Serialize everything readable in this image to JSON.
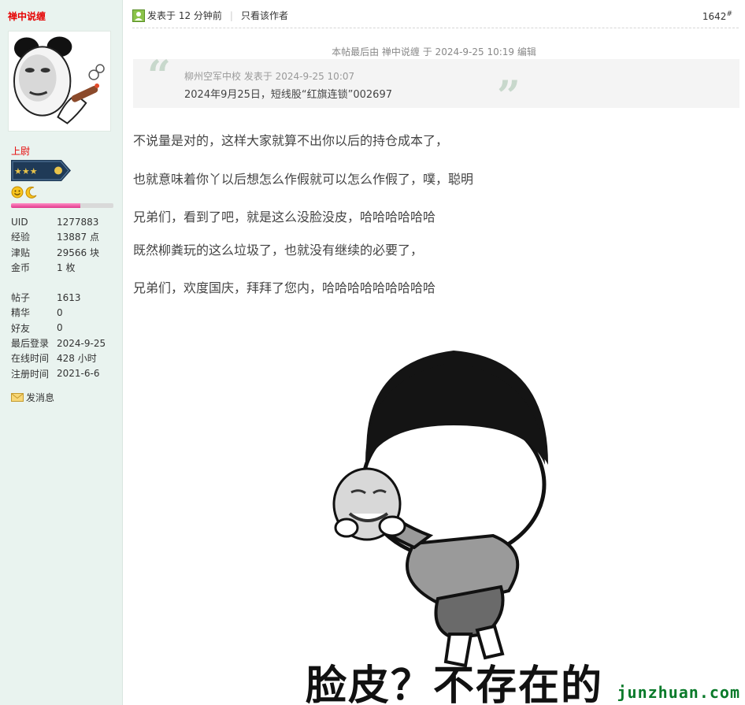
{
  "author": {
    "name": "禅中说缠",
    "rank_title": "上尉",
    "level_progress_pct": 68,
    "send_message_label": "发消息"
  },
  "profile_stats": [
    {
      "label": "UID",
      "value": "1277883"
    },
    {
      "label": "经验",
      "value": "13887 点"
    },
    {
      "label": "津贴",
      "value": "29566 块"
    },
    {
      "label": "金币",
      "value": "1 枚"
    }
  ],
  "profile_stats2": [
    {
      "label": "帖子",
      "value": "1613"
    },
    {
      "label": "精华",
      "value": "0"
    },
    {
      "label": "好友",
      "value": "0"
    },
    {
      "label": "最后登录",
      "value": "2024-9-25"
    },
    {
      "label": "在线时间",
      "value": "428 小时"
    },
    {
      "label": "注册时间",
      "value": "2021-6-6"
    }
  ],
  "post_header": {
    "posted": "发表于 12 分钟前",
    "separator": "|",
    "only_author": "只看该作者",
    "floor_number": "1642",
    "floor_suffix": "#"
  },
  "edit_note": "本帖最后由 禅中说缠 于 2024-9-25 10:19 编辑",
  "quote": {
    "author_line": "柳州空军中校 发表于 2024-9-25 10:07",
    "text": "2024年9月25日，短线股“红旗连锁”002697"
  },
  "paragraphs": [
    "不说量是对的，这样大家就算不出你以后的持仓成本了，",
    "也就意味着你丫以后想怎么作假就可以怎么作假了，噗，聪明",
    "兄弟们，看到了吧，就是这么没脸没皮，哈哈哈哈哈哈",
    "既然柳粪玩的这么垃圾了，也就没有继续的必要了，",
    "兄弟们，欢度国庆，拜拜了您内，哈哈哈哈哈哈哈哈哈"
  ],
  "meme_caption": "脸皮？不存在的",
  "watermark": "junzhuan.com",
  "colors": {
    "sidebar_bg": "#e9f3ef",
    "username": "#e60000",
    "watermark": "#0a7a2a",
    "progress": "#e0388c"
  }
}
